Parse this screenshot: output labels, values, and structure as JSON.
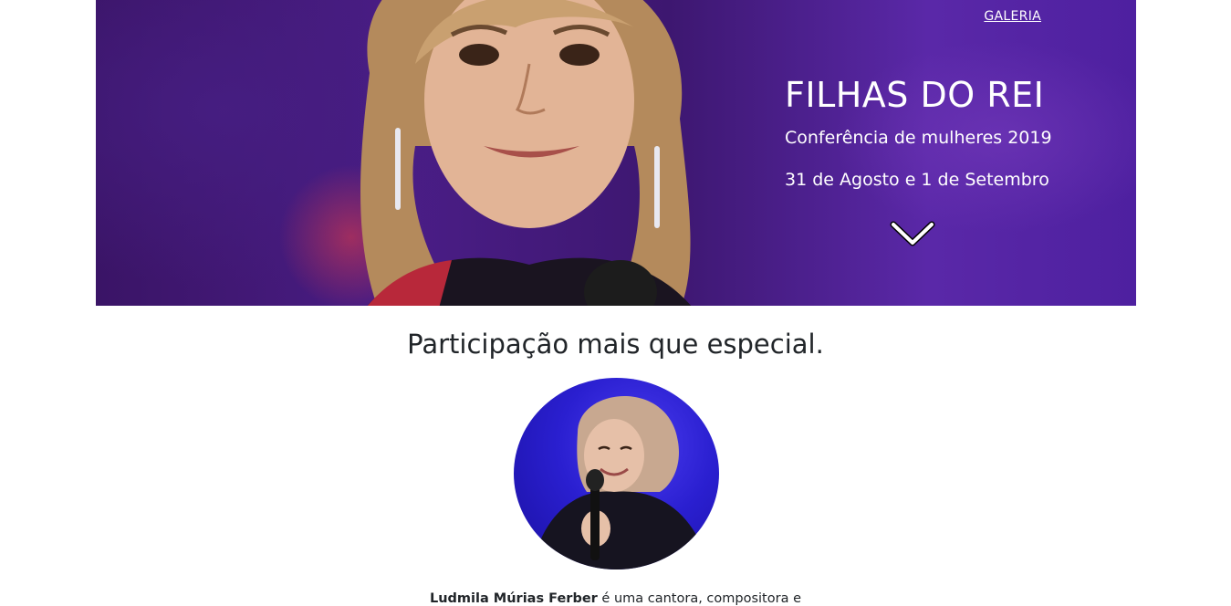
{
  "nav": {
    "gallery_label": "GALERIA"
  },
  "hero": {
    "title": "FILHAS DO REI",
    "subtitle": "Conferência de mulheres 2019",
    "date": "31 de Agosto e 1 de Setembro",
    "scroll_icon": "chevron-down-icon",
    "background_color": "#4a1d86"
  },
  "section": {
    "title": "Participação mais que especial."
  },
  "guest": {
    "name": "Ludmila Múrias Ferber",
    "bio_text": " é uma cantora, compositora e",
    "avatar_background": "#2a1fd0"
  }
}
